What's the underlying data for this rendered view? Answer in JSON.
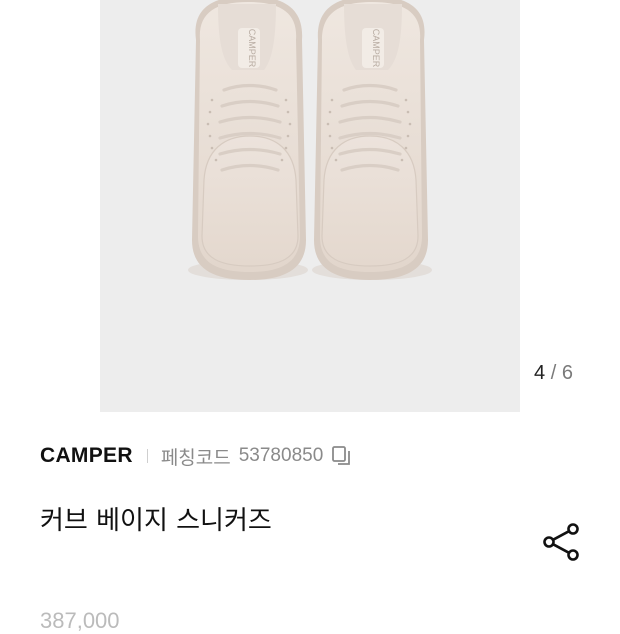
{
  "gallery": {
    "current": "4",
    "separator": "/",
    "total": "6",
    "shoe_tongue_text": "CAMPER"
  },
  "product": {
    "brand": "CAMPER",
    "code_label": "페칭코드",
    "code_value": "53780850",
    "title": "커브 베이지 스니커즈",
    "price": "387,000"
  },
  "icons": {
    "copy": "copy-icon",
    "share": "share-icon"
  },
  "colors": {
    "gallery_bg": "#ededed",
    "shoe": "#e8ded6",
    "text_primary": "#111111",
    "text_muted": "#8a8a8a"
  }
}
